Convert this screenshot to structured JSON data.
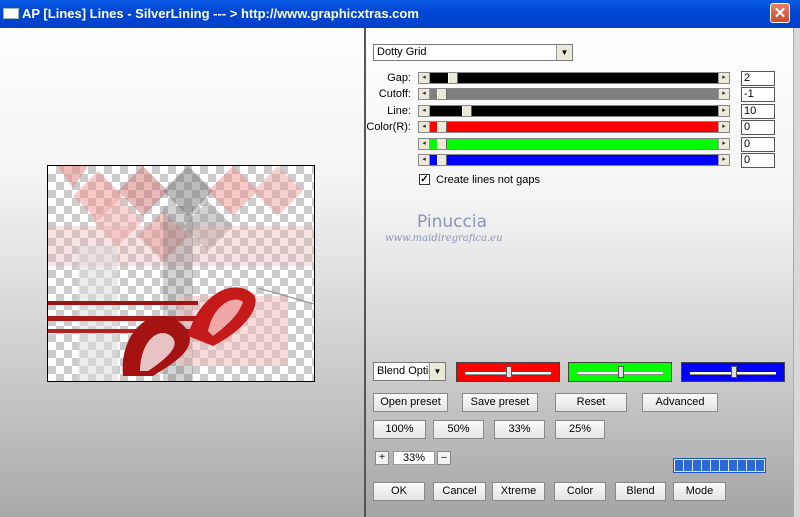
{
  "window": {
    "title": "AP [Lines]  Lines - SilverLining      --- > http://www.graphicxtras.com",
    "close_symbol": "✕"
  },
  "preset_select": {
    "value": "Dotty Grid"
  },
  "params": [
    {
      "label": "Gap:",
      "value": "2",
      "fill": "#000000",
      "thumb_pct": 4
    },
    {
      "label": "Cutoff:",
      "value": "-1",
      "fill": "#808080",
      "thumb_pct": 0
    },
    {
      "label": "Line:",
      "value": "10",
      "fill": "#000000",
      "thumb_pct": 9
    },
    {
      "label": "Color(R):",
      "value": "0",
      "fill": "#ff0000",
      "thumb_pct": 0
    },
    {
      "label": "",
      "value": "0",
      "fill": "#00ff00",
      "thumb_pct": 0
    },
    {
      "label": "",
      "value": "0",
      "fill": "#0000ff",
      "thumb_pct": 0
    }
  ],
  "checkbox": {
    "label": "Create lines not gaps",
    "checked": true,
    "mark": "✓"
  },
  "watermark": {
    "name": "Pinuccia",
    "site": "www.maidiregrafica.eu"
  },
  "blend_select": {
    "value": "Blend Optio"
  },
  "blend_colors": [
    {
      "color": "#ff0000",
      "pct": 50
    },
    {
      "color": "#00ff00",
      "pct": 50
    },
    {
      "color": "#0000ff",
      "pct": 50
    }
  ],
  "preset_buttons": [
    "Open preset",
    "Save preset",
    "Reset",
    "Advanced"
  ],
  "zoom_buttons": [
    "100%",
    "50%",
    "33%",
    "25%"
  ],
  "zoom": {
    "plus": "+",
    "value": "33%",
    "minus": "–"
  },
  "progress_segments": 10,
  "bottom_buttons": [
    "OK",
    "Cancel",
    "Xtreme",
    "Color",
    "Blend",
    "Mode"
  ]
}
